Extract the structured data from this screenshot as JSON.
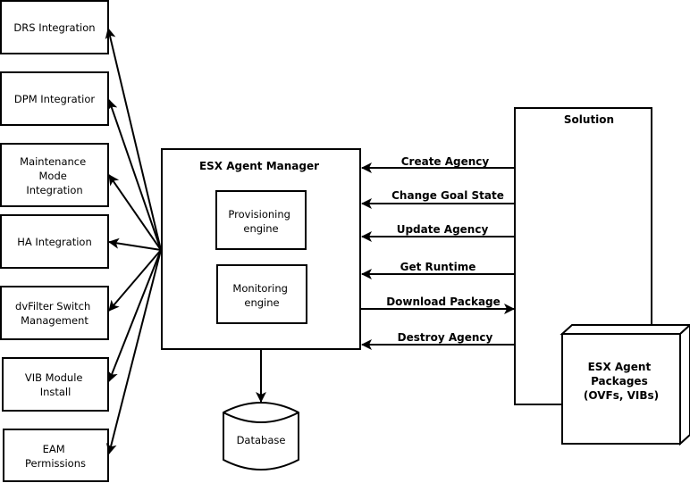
{
  "integrations": [
    {
      "id": "drs",
      "lines": [
        "DRS Integration"
      ]
    },
    {
      "id": "dpm",
      "lines": [
        "DPM Integratior"
      ]
    },
    {
      "id": "maintenance-mode",
      "lines": [
        "Maintenance",
        "Mode",
        "Integration"
      ]
    },
    {
      "id": "ha",
      "lines": [
        "HA Integration"
      ]
    },
    {
      "id": "dvfilter",
      "lines": [
        "dvFilter Switch",
        "Management"
      ]
    },
    {
      "id": "vib-module",
      "lines": [
        "VIB Module",
        "Install"
      ]
    },
    {
      "id": "eam-permissions",
      "lines": [
        "EAM",
        "Permissions"
      ]
    }
  ],
  "manager": {
    "title": "ESX Agent Manager",
    "engines": [
      {
        "id": "provisioning",
        "lines": [
          "Provisioning",
          "engine"
        ]
      },
      {
        "id": "monitoring",
        "lines": [
          "Monitoring",
          "engine"
        ]
      }
    ]
  },
  "solution": {
    "title": "Solution"
  },
  "packages": {
    "lines": [
      "ESX Agent",
      "Packages",
      "(OVFs, VIBs)"
    ]
  },
  "database": {
    "label": "Database"
  },
  "operations": [
    {
      "id": "create-agency",
      "label": "Create Agency",
      "direction": "to-manager"
    },
    {
      "id": "change-goal-state",
      "label": "Change Goal State",
      "direction": "to-manager"
    },
    {
      "id": "update-agency",
      "label": "Update Agency",
      "direction": "to-manager"
    },
    {
      "id": "get-runtime",
      "label": "Get Runtime",
      "direction": "to-manager"
    },
    {
      "id": "download-package",
      "label": "Download Package",
      "direction": "to-solution"
    },
    {
      "id": "destroy-agency",
      "label": "Destroy Agency",
      "direction": "to-manager"
    }
  ]
}
